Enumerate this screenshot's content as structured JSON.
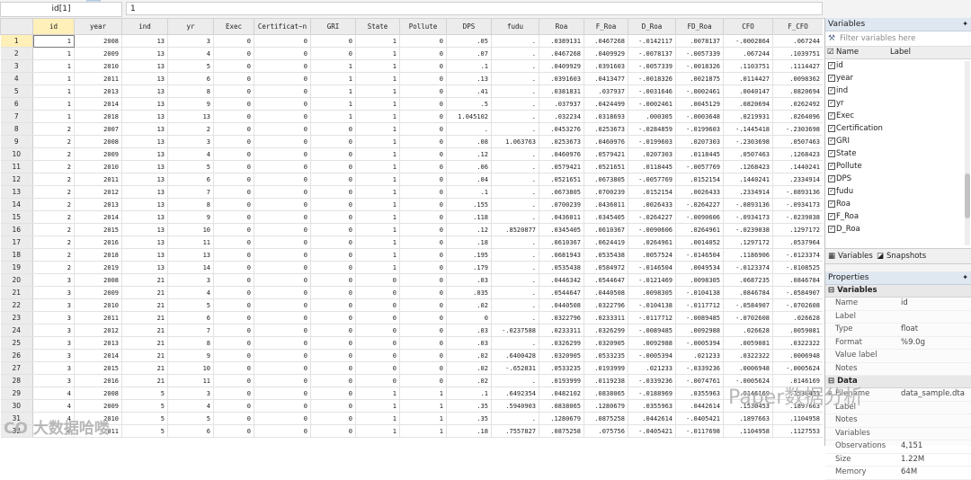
{
  "cell_name": "id[1]",
  "cell_value": "1",
  "columns": [
    "id",
    "year",
    "ind",
    "yr",
    "Exec",
    "Certificat~n",
    "GRI",
    "State",
    "Pollute",
    "DPS",
    "fudu",
    "Roa",
    "F_Roa",
    "D_Roa",
    "FD_Roa",
    "CFO",
    "F_CFO"
  ],
  "rows": [
    {
      "n": "1",
      "c": [
        "1",
        "2008",
        "13",
        "3",
        "0",
        "0",
        "0",
        "1",
        "0",
        ".05",
        ".",
        ".0389131",
        ".0467268",
        "-.0142117",
        ".0078137",
        "-.0002864",
        ".067244"
      ]
    },
    {
      "n": "2",
      "c": [
        "1",
        "2009",
        "13",
        "4",
        "0",
        "0",
        "0",
        "1",
        "0",
        ".07",
        ".",
        ".0467268",
        ".0409929",
        "-.0078137",
        "-.0057339",
        ".067244",
        ".1039751"
      ]
    },
    {
      "n": "3",
      "c": [
        "1",
        "2010",
        "13",
        "5",
        "0",
        "0",
        "1",
        "1",
        "0",
        ".1",
        ".",
        ".0409929",
        ".0391603",
        "-.0057339",
        "-.0018326",
        ".1103751",
        ".1114427"
      ]
    },
    {
      "n": "4",
      "c": [
        "1",
        "2011",
        "13",
        "6",
        "0",
        "0",
        "1",
        "1",
        "0",
        ".13",
        ".",
        ".0391603",
        ".0413477",
        "-.0018326",
        ".0021875",
        ".0114427",
        ".0098362"
      ]
    },
    {
      "n": "5",
      "c": [
        "1",
        "2013",
        "13",
        "8",
        "0",
        "0",
        "1",
        "1",
        "0",
        ".41",
        ".",
        ".0381831",
        ".037937",
        "-.0031646",
        "-.0002461",
        ".0040147",
        ".0820694"
      ]
    },
    {
      "n": "6",
      "c": [
        "1",
        "2014",
        "13",
        "9",
        "0",
        "0",
        "1",
        "1",
        "0",
        ".5",
        ".",
        ".037937",
        ".0424499",
        "-.0002461",
        ".0045129",
        ".0820694",
        ".0262492"
      ]
    },
    {
      "n": "7",
      "c": [
        "1",
        "2018",
        "13",
        "13",
        "0",
        "0",
        "1",
        "1",
        "0",
        "1.045102",
        ".",
        ".032234",
        ".0318693",
        ".000305",
        "-.0003648",
        ".0219931",
        ".0264096"
      ]
    },
    {
      "n": "8",
      "c": [
        "2",
        "2007",
        "13",
        "2",
        "0",
        "0",
        "0",
        "1",
        "0",
        ".",
        ".",
        ".0453276",
        ".0253673",
        "-.0284859",
        "-.0199603",
        "-.1445418",
        "-.2303698"
      ]
    },
    {
      "n": "9",
      "c": [
        "2",
        "2008",
        "13",
        "3",
        "0",
        "0",
        "0",
        "1",
        "0",
        ".08",
        "1.063763",
        ".0253673",
        ".0460976",
        "-.0199603",
        ".0207303",
        "-.2303698",
        ".0507463"
      ]
    },
    {
      "n": "10",
      "c": [
        "2",
        "2009",
        "13",
        "4",
        "0",
        "0",
        "0",
        "1",
        "0",
        ".12",
        ".",
        ".0460976",
        ".0579421",
        ".0207303",
        ".0118445",
        ".0507463",
        ".1268423"
      ]
    },
    {
      "n": "11",
      "c": [
        "2",
        "2010",
        "13",
        "5",
        "0",
        "0",
        "0",
        "1",
        "0",
        ".06",
        ".",
        ".0579421",
        ".0521651",
        ".0118445",
        "-.0057769",
        ".1268423",
        ".1440241"
      ]
    },
    {
      "n": "12",
      "c": [
        "2",
        "2011",
        "13",
        "6",
        "0",
        "0",
        "0",
        "1",
        "0",
        ".04",
        ".",
        ".0521651",
        ".0673805",
        "-.0057769",
        ".0152154",
        ".1440241",
        ".2334914"
      ]
    },
    {
      "n": "13",
      "c": [
        "2",
        "2012",
        "13",
        "7",
        "0",
        "0",
        "0",
        "1",
        "0",
        ".1",
        ".",
        ".0673805",
        ".0700239",
        ".0152154",
        ".0026433",
        ".2334914",
        "-.0893136"
      ]
    },
    {
      "n": "14",
      "c": [
        "2",
        "2013",
        "13",
        "8",
        "0",
        "0",
        "0",
        "1",
        "0",
        ".155",
        ".",
        ".0700239",
        ".0436011",
        ".0026433",
        "-.0264227",
        "-.0893136",
        "-.0934173"
      ]
    },
    {
      "n": "15",
      "c": [
        "2",
        "2014",
        "13",
        "9",
        "0",
        "0",
        "0",
        "1",
        "0",
        ".118",
        ".",
        ".0436011",
        ".0345405",
        "-.0264227",
        "-.0090606",
        "-.0934173",
        "-.0239038"
      ]
    },
    {
      "n": "16",
      "c": [
        "2",
        "2015",
        "13",
        "10",
        "0",
        "0",
        "0",
        "1",
        "0",
        ".12",
        ".8520877",
        ".0345405",
        ".0610367",
        "-.0090606",
        ".0264961",
        "-.0239038",
        ".1297172"
      ]
    },
    {
      "n": "17",
      "c": [
        "2",
        "2016",
        "13",
        "11",
        "0",
        "0",
        "0",
        "1",
        "0",
        ".18",
        ".",
        ".0610367",
        ".0624419",
        ".0264961",
        ".0014052",
        ".1297172",
        ".0537964"
      ]
    },
    {
      "n": "18",
      "c": [
        "2",
        "2018",
        "13",
        "13",
        "0",
        "0",
        "0",
        "1",
        "0",
        ".195",
        ".",
        ".0681943",
        ".0535438",
        ".0057524",
        "-.0146504",
        ".1186906",
        "-.0123374"
      ]
    },
    {
      "n": "19",
      "c": [
        "2",
        "2019",
        "13",
        "14",
        "0",
        "0",
        "0",
        "1",
        "0",
        ".179",
        ".",
        ".0535438",
        ".0584972",
        "-.0146504",
        ".0049534",
        "-.0123374",
        "-.0108525"
      ]
    },
    {
      "n": "20",
      "c": [
        "3",
        "2008",
        "21",
        "3",
        "0",
        "0",
        "0",
        "0",
        "0",
        ".03",
        ".",
        ".0446342",
        ".0544647",
        "-.0121469",
        ".0098305",
        ".0687235",
        ".0846784"
      ]
    },
    {
      "n": "21",
      "c": [
        "3",
        "2009",
        "21",
        "4",
        "0",
        "0",
        "0",
        "0",
        "0",
        ".035",
        ".",
        ".0544647",
        ".0440508",
        ".0098305",
        "-.0104138",
        ".0846784",
        "-.0584907"
      ]
    },
    {
      "n": "22",
      "c": [
        "3",
        "2010",
        "21",
        "5",
        "0",
        "0",
        "0",
        "0",
        "0",
        ".02",
        ".",
        ".0440508",
        ".0322796",
        "-.0104138",
        "-.0117712",
        "-.0584907",
        "-.0702608"
      ]
    },
    {
      "n": "23",
      "c": [
        "3",
        "2011",
        "21",
        "6",
        "0",
        "0",
        "0",
        "0",
        "0",
        "0",
        ".",
        ".0322796",
        ".0233311",
        "-.0117712",
        "-.0089485",
        "-.0702608",
        ".026628"
      ]
    },
    {
      "n": "24",
      "c": [
        "3",
        "2012",
        "21",
        "7",
        "0",
        "0",
        "0",
        "0",
        "0",
        ".03",
        "-.0237588",
        ".0233311",
        ".0326299",
        "-.0089485",
        ".0092988",
        ".026628",
        ".0059081"
      ]
    },
    {
      "n": "25",
      "c": [
        "3",
        "2013",
        "21",
        "8",
        "0",
        "0",
        "0",
        "0",
        "0",
        ".03",
        ".",
        ".0326299",
        ".0320905",
        ".0092988",
        "-.0005394",
        ".0059081",
        ".0322322"
      ]
    },
    {
      "n": "26",
      "c": [
        "3",
        "2014",
        "21",
        "9",
        "0",
        "0",
        "0",
        "0",
        "0",
        ".02",
        ".6400428",
        ".0320905",
        ".0533235",
        "-.0005394",
        ".021233",
        ".0322322",
        ".0006948"
      ]
    },
    {
      "n": "27",
      "c": [
        "3",
        "2015",
        "21",
        "10",
        "0",
        "0",
        "0",
        "0",
        "0",
        ".02",
        "-.652831",
        ".0533235",
        ".0193999",
        ".021233",
        "-.0339236",
        ".0006948",
        "-.0005624"
      ]
    },
    {
      "n": "28",
      "c": [
        "3",
        "2016",
        "21",
        "11",
        "0",
        "0",
        "0",
        "0",
        "0",
        ".02",
        ".",
        ".0193999",
        ".0119238",
        "-.0339236",
        "-.0074761",
        "-.0005624",
        ".0146169"
      ]
    },
    {
      "n": "29",
      "c": [
        "4",
        "2008",
        "5",
        "3",
        "0",
        "0",
        "0",
        "1",
        "1",
        ".1",
        ".6492354",
        ".0482102",
        ".0838065",
        "-.0188969",
        ".0355963",
        ".0146169",
        ".1530453"
      ]
    },
    {
      "n": "30",
      "c": [
        "4",
        "2009",
        "5",
        "4",
        "0",
        "0",
        "0",
        "1",
        "1",
        ".35",
        ".5940903",
        ".0838065",
        ".1280679",
        ".0355963",
        ".0442614",
        ".1530453",
        ".1897663"
      ]
    },
    {
      "n": "31",
      "c": [
        "4",
        "2010",
        "5",
        "5",
        "0",
        "0",
        "0",
        "1",
        "1",
        ".35",
        ".",
        ".1280679",
        ".0875258",
        ".0442614",
        "-.0405421",
        ".1897663",
        ".1104958"
      ]
    },
    {
      "n": "32",
      "c": [
        "4",
        "2011",
        "5",
        "6",
        "0",
        "0",
        "0",
        "1",
        "1",
        ".18",
        ".7557827",
        ".0875258",
        ".075756",
        "-.0405421",
        "-.0117698",
        ".1104958",
        ".1127553"
      ]
    }
  ],
  "variables_panel": {
    "title": "Variables",
    "filter_placeholder": "Filter variables here",
    "col_name": "Name",
    "col_label": "Label",
    "items": [
      "id",
      "year",
      "ind",
      "yr",
      "Exec",
      "Certification",
      "GRI",
      "State",
      "Pollute",
      "DPS",
      "fudu",
      "Roa",
      "F_Roa",
      "D_Roa"
    ],
    "tab_variables": "Variables",
    "tab_snapshots": "Snapshots"
  },
  "properties_panel": {
    "title": "Properties",
    "section_variables": "Variables",
    "variables": [
      {
        "k": "Name",
        "v": "id"
      },
      {
        "k": "Label",
        "v": ""
      },
      {
        "k": "Type",
        "v": "float"
      },
      {
        "k": "Format",
        "v": "%9.0g"
      },
      {
        "k": "Value label",
        "v": ""
      },
      {
        "k": "Notes",
        "v": ""
      }
    ],
    "section_data": "Data",
    "data": [
      {
        "k": "Filename",
        "v": "data_sample.dta"
      },
      {
        "k": "Label",
        "v": ""
      },
      {
        "k": "Notes",
        "v": ""
      },
      {
        "k": "Variables",
        "v": ""
      },
      {
        "k": "Observations",
        "v": "4,151"
      },
      {
        "k": "Size",
        "v": "1.22M"
      },
      {
        "k": "Memory",
        "v": "64M"
      }
    ]
  },
  "watermark_left": "CO 大数据哈喽",
  "watermark_right": "Paper数据分析"
}
